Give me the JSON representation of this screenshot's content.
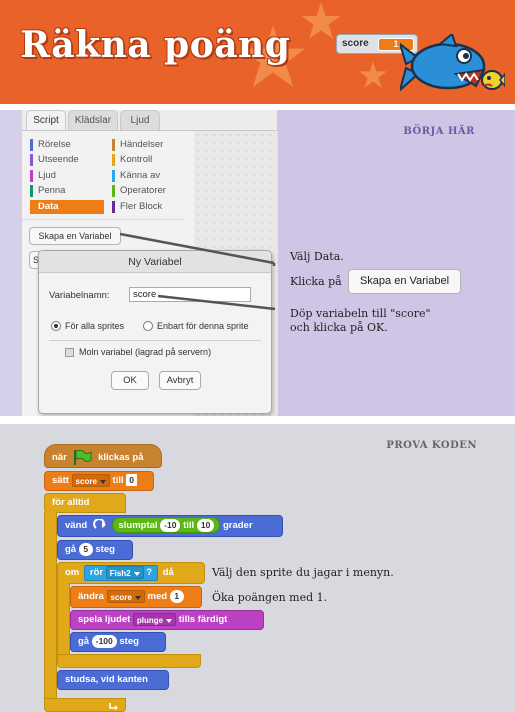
{
  "header": {
    "title": "Räkna poäng",
    "score_monitor": {
      "label": "score",
      "value": "1"
    }
  },
  "editor": {
    "tabs": [
      "Script",
      "Klädslar",
      "Ljud"
    ],
    "categories_left": [
      "Rörelse",
      "Utseende",
      "Ljud",
      "Penna",
      "Data"
    ],
    "categories_right": [
      "Händelser",
      "Kontroll",
      "Känna av",
      "Operatorer",
      "Fler Block"
    ],
    "category_colors_left": [
      "#4a6cd4",
      "#8a55d7",
      "#bb42c3",
      "#0e9a6c",
      "#ee7d16"
    ],
    "category_colors_right": [
      "#c88330",
      "#e1a91a",
      "#2ca5e2",
      "#5cb712",
      "#632d99"
    ],
    "make_variable_button": "Skapa en Variabel",
    "make_list_button": "S"
  },
  "dialog": {
    "title": "Ny Variabel",
    "name_label": "Variabelnamn:",
    "name_value": "score",
    "radio_all": "För alla sprites",
    "radio_this": "Enbart för denna sprite",
    "cloud_checkbox": "Moln variabel (lagrad på servern)",
    "ok_button": "OK",
    "cancel_button": "Avbryt"
  },
  "section1": {
    "heading": "BÖRJA HÄR",
    "step1": "Välj Data.",
    "step2_prefix": "Klicka på",
    "step2_button": "Skapa en Variabel",
    "step3_line1": "Döp variabeln till \"score\"",
    "step3_line2": "och klicka på OK."
  },
  "section2": {
    "heading": "PROVA KODEN",
    "note_sensing": "Välj den sprite du jagar i menyn.",
    "note_change": "Öka poängen med 1."
  },
  "blocks": {
    "when_flag_pre": "när",
    "when_flag_post": "klickas på",
    "set_pre": "sätt",
    "set_var": "score",
    "set_mid": "till",
    "set_val": "0",
    "forever": "för alltid",
    "turn_pre": "vänd",
    "turn_op": "slumptal",
    "turn_from": "-10",
    "turn_mid": "till",
    "turn_to": "10",
    "turn_post": "grader",
    "move1_pre": "gå",
    "move1_val": "5",
    "move1_post": "steg",
    "if_pre": "om",
    "touch_pre": "rör",
    "touch_target": "Fish2",
    "touch_q": "?",
    "if_post": "då",
    "change_pre": "ändra",
    "change_var": "score",
    "change_mid": "med",
    "change_val": "1",
    "sound_pre": "spela ljudet",
    "sound_name": "plunge",
    "sound_post": "tills färdigt",
    "move2_pre": "gå",
    "move2_val": "-100",
    "move2_post": "steg",
    "bounce": "studsa, vid kanten"
  }
}
